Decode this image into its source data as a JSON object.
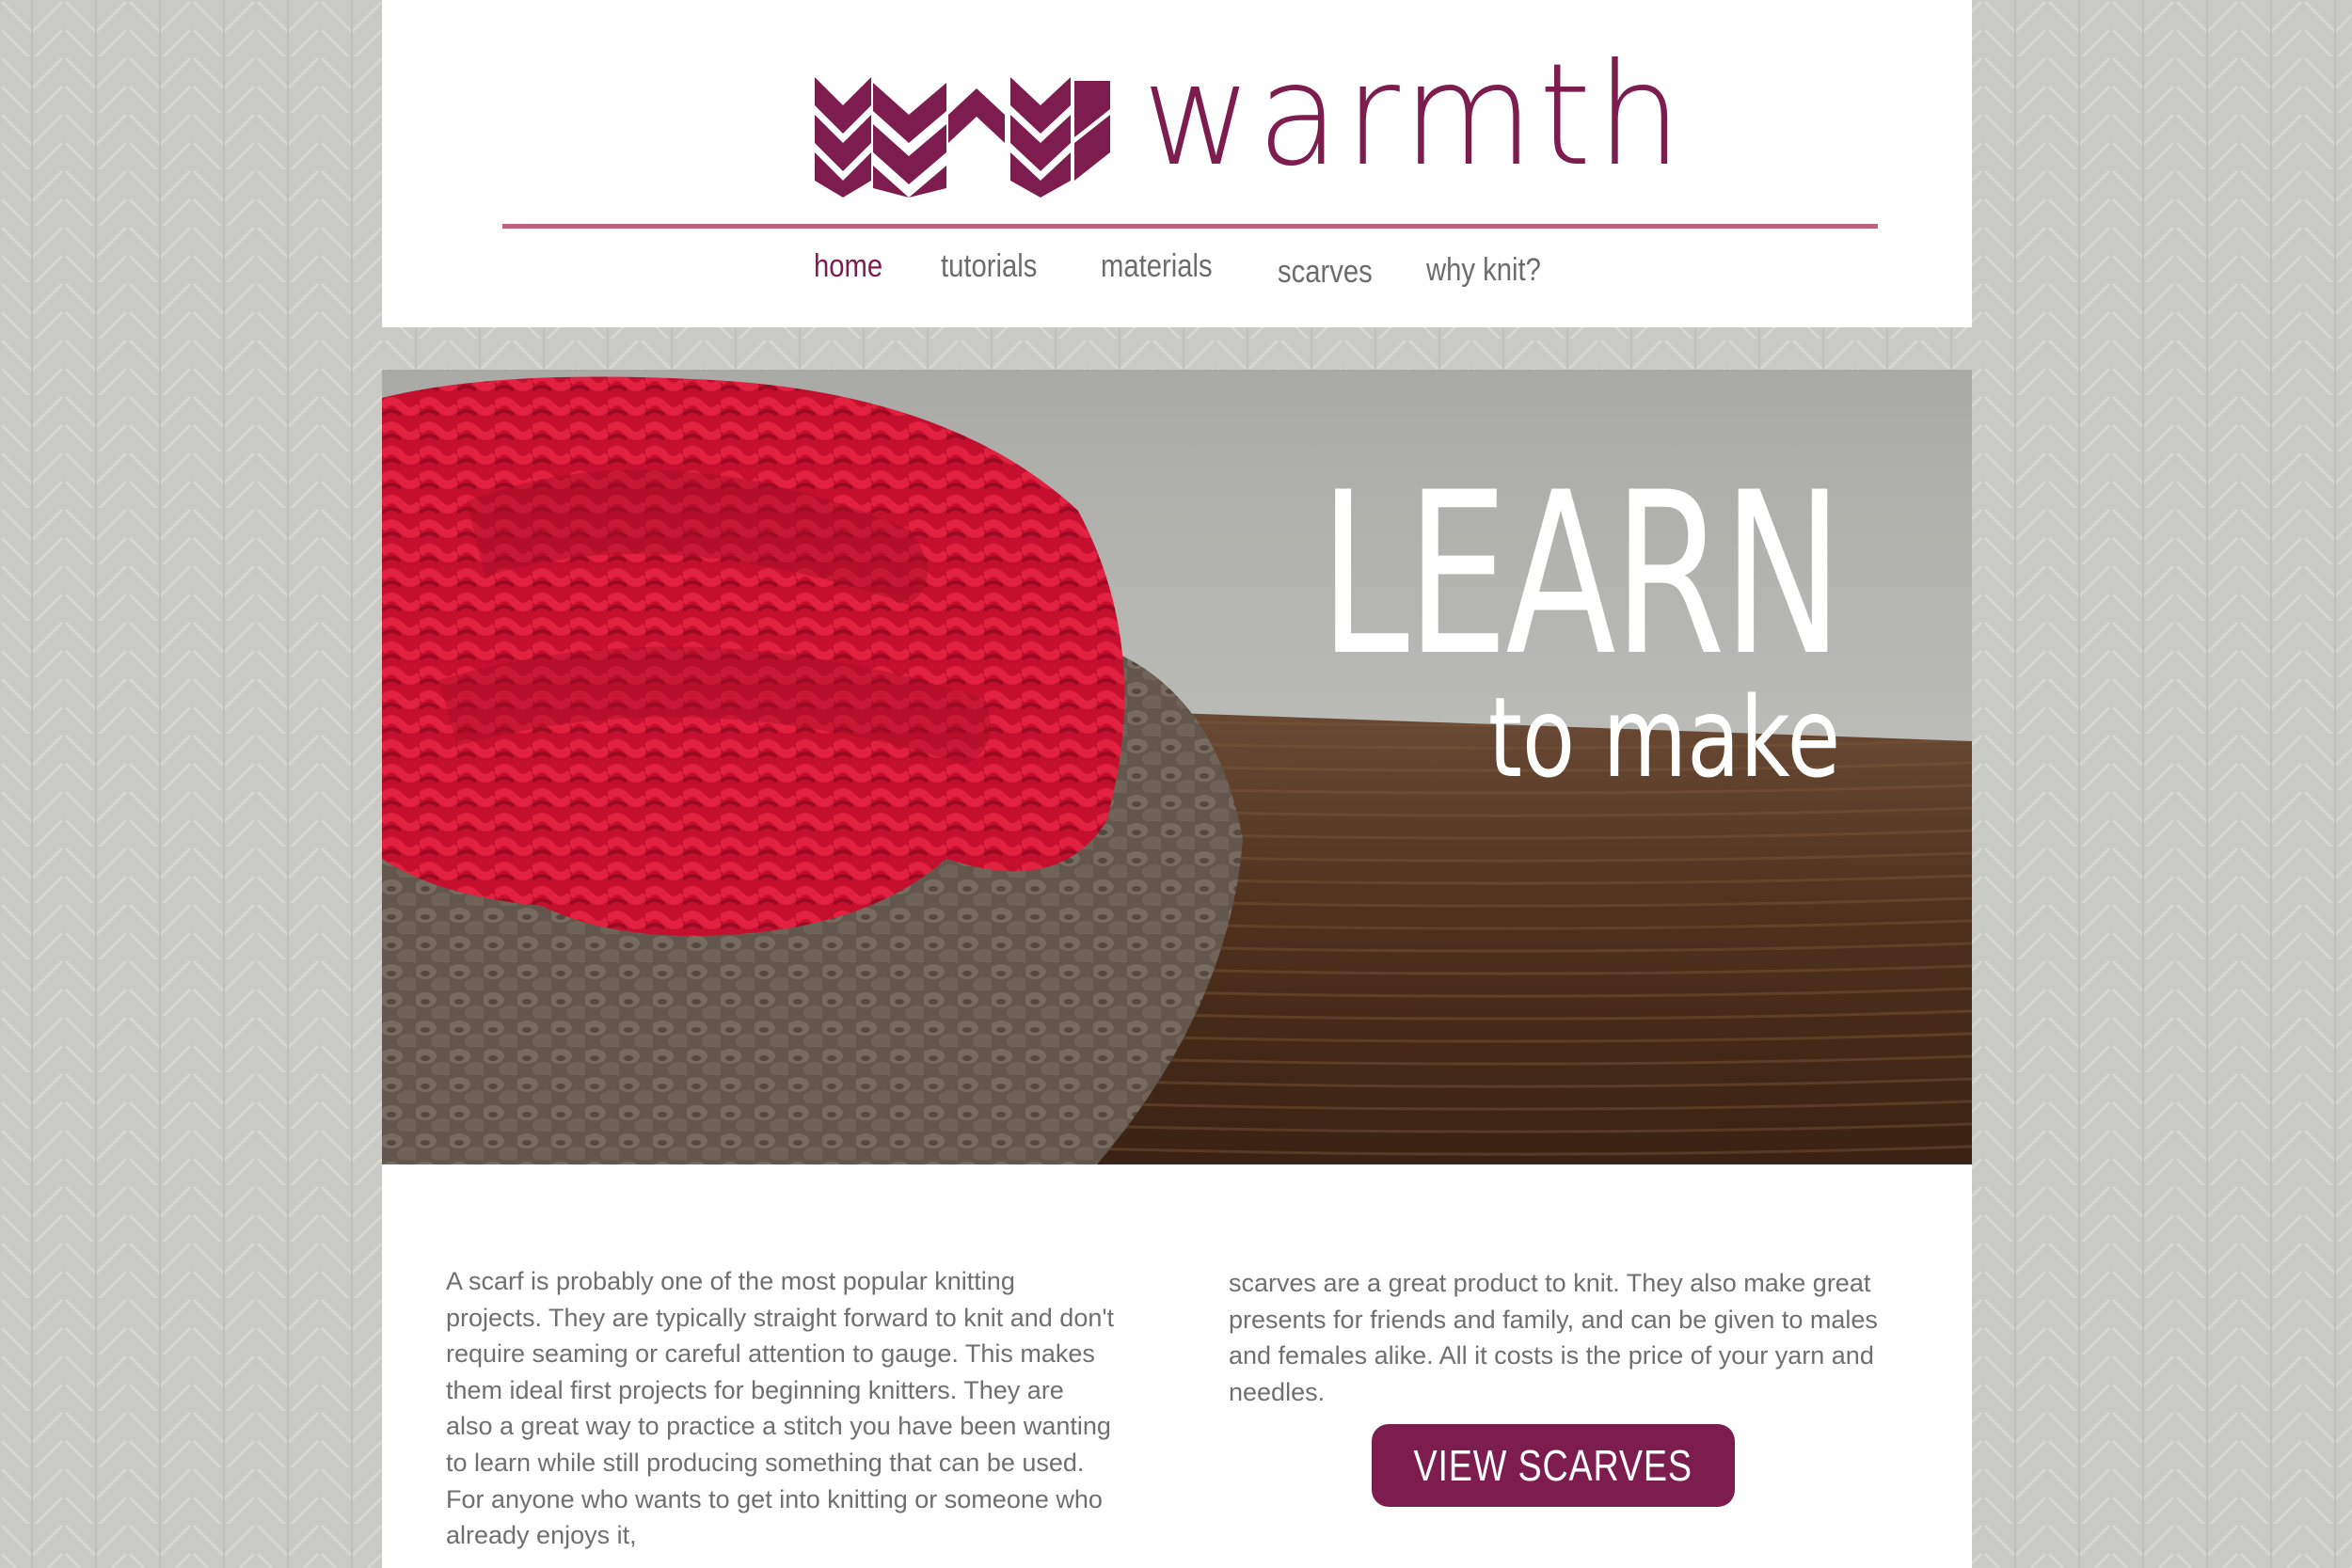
{
  "brand": {
    "name": "warmth",
    "color": "#7d1d4f",
    "accent_rule": "#c0637f"
  },
  "nav": {
    "items": [
      {
        "label": "home",
        "active": true
      },
      {
        "label": "tutorials",
        "active": false
      },
      {
        "label": "materials",
        "active": false
      },
      {
        "label": "scarves",
        "active": false
      },
      {
        "label": "why knit?",
        "active": false
      }
    ]
  },
  "hero": {
    "title_big": "LEARN",
    "title_small": "to make"
  },
  "content": {
    "left_text": "A scarf is probably one of the most popular knitting projects. They are typically straight forward to knit and don't require seaming or careful attention to gauge. This makes them ideal first projects for beginning knitters. They are also a great way to practice a stitch you have been wanting to learn while still producing something that can be used. For anyone who wants to get into knitting or someone who already enjoys it,",
    "right_text": "scarves are a great product to knit. They also make great presents for friends and family, and can be given to males and females alike. All it costs is the price of your yarn and needles.",
    "cta_label": "VIEW SCARVES"
  }
}
